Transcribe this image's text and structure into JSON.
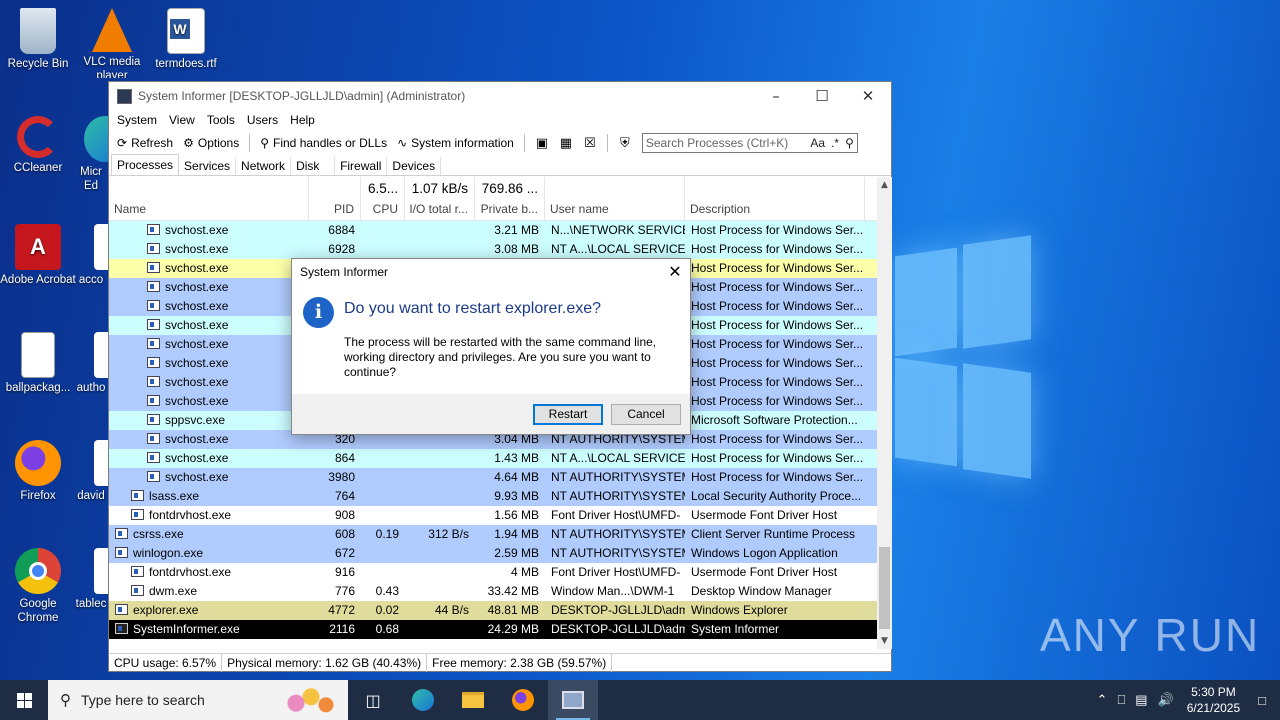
{
  "desktop": {
    "icons": [
      {
        "label": "Recycle Bin"
      },
      {
        "label": "VLC media player"
      },
      {
        "label": "termdoes.rtf"
      },
      {
        "label": "CCleaner"
      },
      {
        "label": "Micr Ed"
      },
      {
        "label": "Adobe Acrobat"
      },
      {
        "label": "acco"
      },
      {
        "label": "ballpackag..."
      },
      {
        "label": "autho"
      },
      {
        "label": "Firefox"
      },
      {
        "label": "david"
      },
      {
        "label": "Google Chrome"
      },
      {
        "label": "tablec"
      }
    ],
    "watermark": "ANY RUN"
  },
  "window": {
    "title": "System Informer [DESKTOP-JGLLJLD\\admin] (Administrator)",
    "menu": [
      "System",
      "View",
      "Tools",
      "Users",
      "Help"
    ],
    "toolbar": {
      "refresh": "Refresh",
      "options": "Options",
      "find": "Find handles or DLLs",
      "sysinfo": "System information",
      "search_placeholder": "Search Processes (Ctrl+K)",
      "search_case": "Aa",
      "search_regex": ".*"
    },
    "tabs": [
      "Processes",
      "Services",
      "Network",
      "Disk",
      "Firewall",
      "Devices"
    ],
    "columns": {
      "name": "Name",
      "pid": "PID",
      "cpu": "CPU",
      "io": "I/O total r...",
      "private": "Private b...",
      "user": "User name",
      "desc": "Description",
      "cpu_total": "6.5...",
      "io_total": "1.07 kB/s",
      "private_total": "769.86 ..."
    },
    "rows": [
      {
        "name": "svchost.exe",
        "pid": "6884",
        "cpu": "",
        "io": "",
        "priv": "3.21 MB",
        "user": "N...\\NETWORK SERVICE",
        "desc": "Host Process for Windows Ser...",
        "level": 3,
        "color": "#ccfdff"
      },
      {
        "name": "svchost.exe",
        "pid": "6928",
        "cpu": "",
        "io": "",
        "priv": "3.08 MB",
        "user": "NT A...\\LOCAL SERVICE",
        "desc": "Host Process for Windows Ser...",
        "level": 3,
        "color": "#ccfdff"
      },
      {
        "name": "svchost.exe",
        "pid": "",
        "cpu": "",
        "io": "",
        "priv": "",
        "user": "",
        "desc": "Host Process for Windows Ser...",
        "level": 3,
        "color": "#fdffa8"
      },
      {
        "name": "svchost.exe",
        "pid": "",
        "cpu": "",
        "io": "",
        "priv": "",
        "user": "",
        "desc": "Host Process for Windows Ser...",
        "level": 3,
        "color": "#b0ccff"
      },
      {
        "name": "svchost.exe",
        "pid": "",
        "cpu": "",
        "io": "",
        "priv": "",
        "user": "",
        "desc": "Host Process for Windows Ser...",
        "level": 3,
        "color": "#b0ccff"
      },
      {
        "name": "svchost.exe",
        "pid": "",
        "cpu": "",
        "io": "",
        "priv": "",
        "user": "",
        "desc": "Host Process for Windows Ser...",
        "level": 3,
        "color": "#ccfdff"
      },
      {
        "name": "svchost.exe",
        "pid": "",
        "cpu": "",
        "io": "",
        "priv": "",
        "user": "",
        "desc": "Host Process for Windows Ser...",
        "level": 3,
        "color": "#b0ccff"
      },
      {
        "name": "svchost.exe",
        "pid": "",
        "cpu": "",
        "io": "",
        "priv": "",
        "user": "",
        "desc": "Host Process for Windows Ser...",
        "level": 3,
        "color": "#b0ccff"
      },
      {
        "name": "svchost.exe",
        "pid": "",
        "cpu": "",
        "io": "",
        "priv": "",
        "user": "",
        "desc": "Host Process for Windows Ser...",
        "level": 3,
        "color": "#b0ccff"
      },
      {
        "name": "svchost.exe",
        "pid": "",
        "cpu": "",
        "io": "",
        "priv": "",
        "user": "",
        "desc": "Host Process for Windows Ser...",
        "level": 3,
        "color": "#b0ccff"
      },
      {
        "name": "sppsvc.exe",
        "pid": "",
        "cpu": "",
        "io": "",
        "priv": "",
        "user": "",
        "desc": "Microsoft Software Protection...",
        "level": 3,
        "color": "#ccfdff"
      },
      {
        "name": "svchost.exe",
        "pid": "320",
        "cpu": "",
        "io": "",
        "priv": "3.04 MB",
        "user": "NT AUTHORITY\\SYSTEM",
        "desc": "Host Process for Windows Ser...",
        "level": 3,
        "color": "#b0ccff"
      },
      {
        "name": "svchost.exe",
        "pid": "864",
        "cpu": "",
        "io": "",
        "priv": "1.43 MB",
        "user": "NT A...\\LOCAL SERVICE",
        "desc": "Host Process for Windows Ser...",
        "level": 3,
        "color": "#ccfdff"
      },
      {
        "name": "svchost.exe",
        "pid": "3980",
        "cpu": "",
        "io": "",
        "priv": "4.64 MB",
        "user": "NT AUTHORITY\\SYSTEM",
        "desc": "Host Process for Windows Ser...",
        "level": 3,
        "color": "#b0ccff"
      },
      {
        "name": "lsass.exe",
        "pid": "764",
        "cpu": "",
        "io": "",
        "priv": "9.93 MB",
        "user": "NT AUTHORITY\\SYSTEM",
        "desc": "Local Security Authority Proce...",
        "level": 2,
        "color": "#b0ccff"
      },
      {
        "name": "fontdrvhost.exe",
        "pid": "908",
        "cpu": "",
        "io": "",
        "priv": "1.56 MB",
        "user": "Font Driver Host\\UMFD-",
        "desc": "Usermode Font Driver Host",
        "level": 2,
        "color": "#ffffff"
      },
      {
        "name": "csrss.exe",
        "pid": "608",
        "cpu": "0.19",
        "io": "312 B/s",
        "priv": "1.94 MB",
        "user": "NT AUTHORITY\\SYSTEM",
        "desc": "Client Server Runtime Process",
        "level": 1,
        "color": "#b0ccff"
      },
      {
        "name": "winlogon.exe",
        "pid": "672",
        "cpu": "",
        "io": "",
        "priv": "2.59 MB",
        "user": "NT AUTHORITY\\SYSTEM",
        "desc": "Windows Logon Application",
        "level": 1,
        "color": "#b0ccff",
        "expanded": "⌄"
      },
      {
        "name": "fontdrvhost.exe",
        "pid": "916",
        "cpu": "",
        "io": "",
        "priv": "4 MB",
        "user": "Font Driver Host\\UMFD-",
        "desc": "Usermode Font Driver Host",
        "level": 2,
        "color": "#ffffff"
      },
      {
        "name": "dwm.exe",
        "pid": "776",
        "cpu": "0.43",
        "io": "",
        "priv": "33.42 MB",
        "user": "Window Man...\\DWM-1",
        "desc": "Desktop Window Manager",
        "level": 2,
        "color": "#ffffff"
      },
      {
        "name": "explorer.exe",
        "pid": "4772",
        "cpu": "0.02",
        "io": "44 B/s",
        "priv": "48.81 MB",
        "user": "DESKTOP-JGLLJLD\\admi",
        "desc": "Windows Explorer",
        "level": 1,
        "color": "#e0dc9c"
      },
      {
        "name": "SystemInformer.exe",
        "pid": "2116",
        "cpu": "0.68",
        "io": "",
        "priv": "24.29 MB",
        "user": "DESKTOP-JGLLJLD\\admi",
        "desc": "System Informer",
        "level": 1,
        "color": "#000000",
        "selected": true
      }
    ],
    "status": {
      "cpu": "CPU usage: 6.57%",
      "phys": "Physical memory: 1.62 GB (40.43%)",
      "free": "Free memory: 2.38 GB (59.57%)"
    }
  },
  "dialog": {
    "title": "System Informer",
    "heading": "Do you want to restart explorer.exe?",
    "body": "The process will be restarted with the same command line, working directory and privileges. Are you sure you want to continue?",
    "ok": "Restart",
    "cancel": "Cancel"
  },
  "taskbar": {
    "search_placeholder": "Type here to search",
    "time": "5:30 PM",
    "date": "6/21/2025"
  }
}
